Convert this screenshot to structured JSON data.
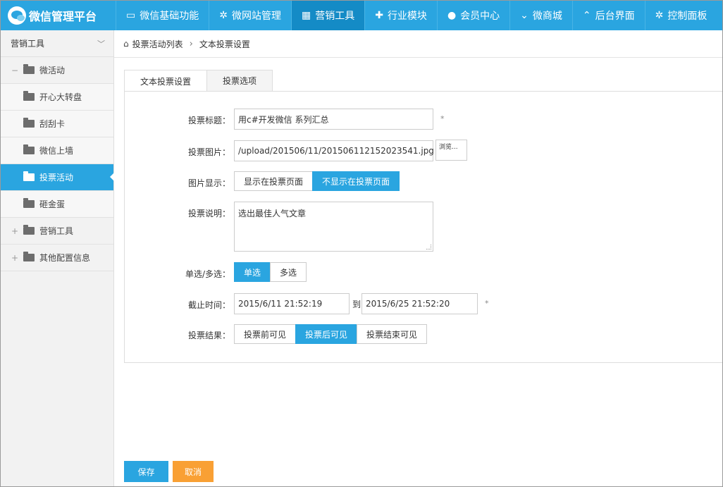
{
  "app": {
    "title": "微信管理平台"
  },
  "nav": {
    "items": [
      {
        "label": "微信基础功能",
        "icon": "monitor-icon",
        "glyph": "▭"
      },
      {
        "label": "微网站管理",
        "icon": "gear-icon",
        "glyph": "✲"
      },
      {
        "label": "营销工具",
        "icon": "grid-icon",
        "glyph": "▦"
      },
      {
        "label": "行业模块",
        "icon": "puzzle-icon",
        "glyph": "✚"
      },
      {
        "label": "会员中心",
        "icon": "user-icon",
        "glyph": "●"
      },
      {
        "label": "微商城",
        "icon": "chevron-down-icon",
        "glyph": "⌄"
      },
      {
        "label": "后台界面",
        "icon": "chevron-up-icon",
        "glyph": "⌃"
      },
      {
        "label": "控制面板",
        "icon": "settings-icon",
        "glyph": "✲"
      }
    ],
    "active_index": 2
  },
  "sidebar": {
    "header": "营销工具",
    "items": [
      {
        "label": "微活动",
        "type": "group",
        "expander": "−"
      },
      {
        "label": "开心大转盘",
        "type": "sub"
      },
      {
        "label": "刮刮卡",
        "type": "sub"
      },
      {
        "label": "微信上墙",
        "type": "sub"
      },
      {
        "label": "投票活动",
        "type": "sub",
        "active": true
      },
      {
        "label": "砸金蛋",
        "type": "sub"
      },
      {
        "label": "营销工具",
        "type": "group",
        "expander": "+"
      },
      {
        "label": "其他配置信息",
        "type": "group",
        "expander": "+"
      }
    ]
  },
  "breadcrumb": {
    "parent": "投票活动列表",
    "current": "文本投票设置"
  },
  "tabs": [
    {
      "label": "文本投票设置",
      "active": true
    },
    {
      "label": "投票选项",
      "active": false
    }
  ],
  "form": {
    "title_label": "投票标题：",
    "title_value": "用c#开发微信 系列汇总",
    "title_required": "*",
    "image_label": "投票图片：",
    "image_value": "/upload/201506/11/201506112152023541.jpg",
    "browse_label": "浏览...",
    "display_label": "图片显示：",
    "display_options": [
      "显示在投票页面",
      "不显示在投票页面"
    ],
    "display_selected": 1,
    "desc_label": "投票说明：",
    "desc_value": "选出最佳人气文章",
    "mode_label": "单选/多选：",
    "mode_options": [
      "单选",
      "多选"
    ],
    "mode_selected": 0,
    "deadline_label": "截止时间：",
    "start_time": "2015/6/11 21:52:19",
    "to_label": "到",
    "end_time": "2015/6/25 21:52:20",
    "deadline_required": "*",
    "result_label": "投票结果：",
    "result_options": [
      "投票前可见",
      "投票后可见",
      "投票结束可见"
    ],
    "result_selected": 1
  },
  "footer": {
    "save_label": "保存",
    "cancel_label": "取消"
  },
  "colors": {
    "primary": "#2aa5e0",
    "active_nav": "#148bc6",
    "cancel": "#f9a034"
  }
}
